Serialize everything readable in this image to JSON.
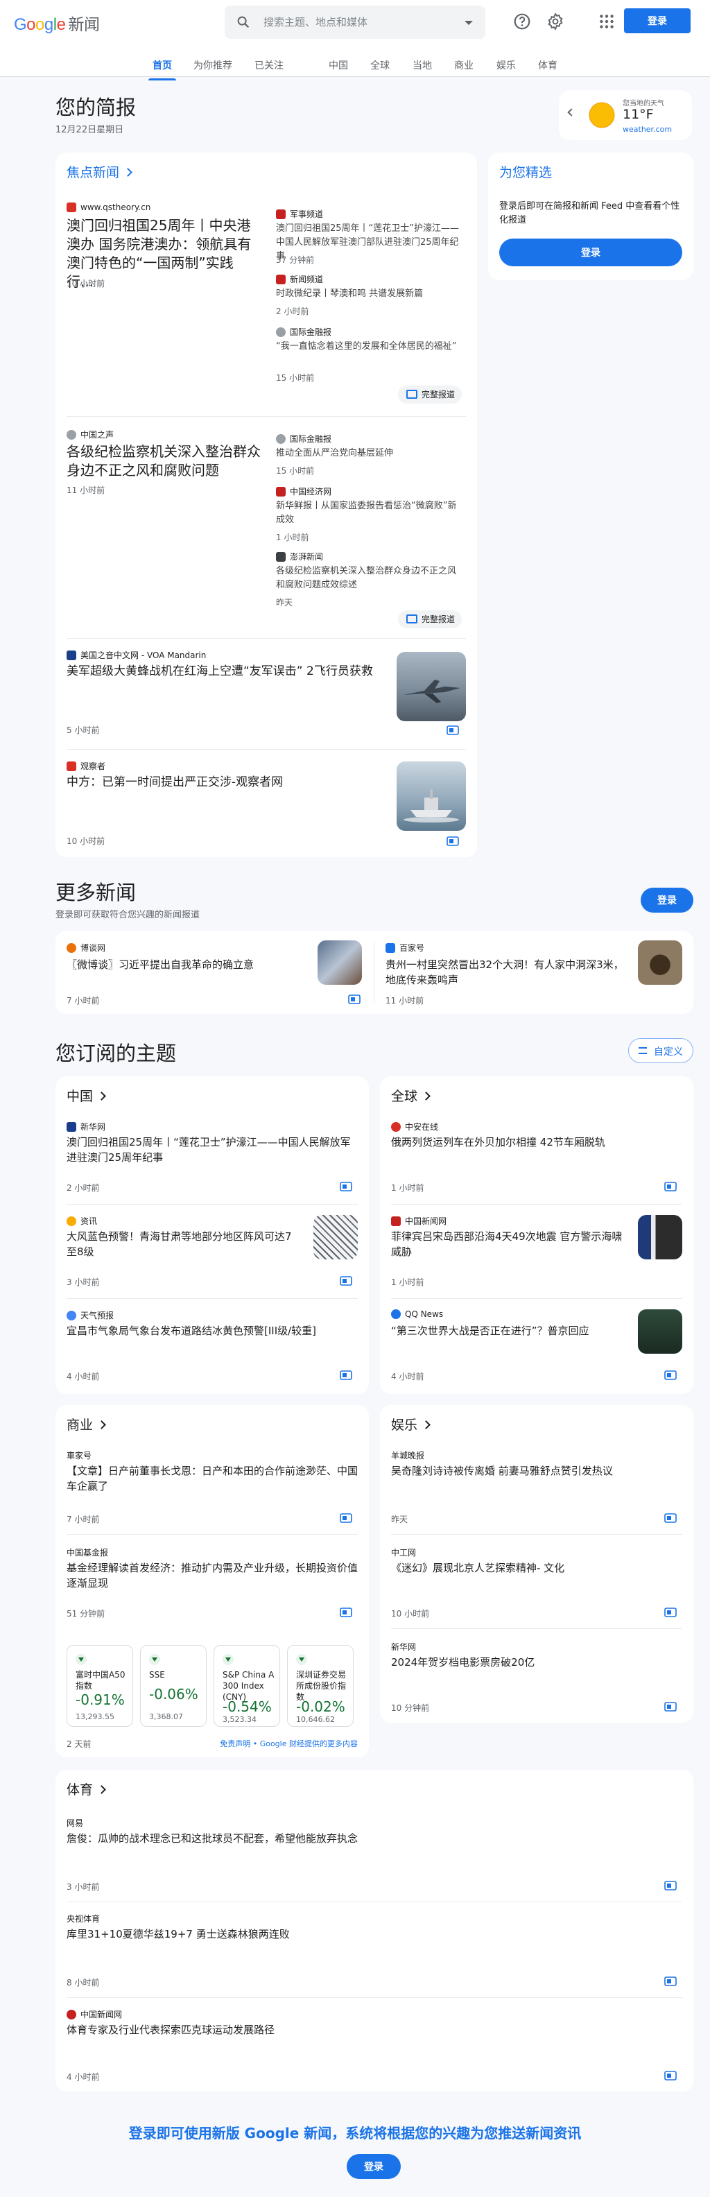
{
  "header": {
    "logo_letters": [
      "G",
      "o",
      "o",
      "g",
      "l",
      "e"
    ],
    "product": "新闻",
    "search_placeholder": "搜索主题、地点和媒体",
    "signin": "登录"
  },
  "tabs": [
    "首页",
    "为你推荐",
    "已关注",
    "中国",
    "全球",
    "当地",
    "商业",
    "娱乐",
    "体育"
  ],
  "briefing": {
    "title": "您的简报",
    "date": "12月22日星期日"
  },
  "weather": {
    "label": "您当地的天气",
    "temp": "11°F",
    "source": "weather.com"
  },
  "picks": {
    "title": "为您精选",
    "desc": "登录后即可在简报和新闻 Feed 中查看看个性化报道",
    "button": "登录"
  },
  "top": {
    "title": "焦点新闻",
    "s1": {
      "main": {
        "source": "www.qstheory.cn",
        "title": "澳门回归祖国25周年丨中央港澳办 国务院港澳办：领航具有澳门特色的“一国两制”实践行...",
        "time": "10 小时前"
      },
      "side": [
        {
          "source": "军事频道",
          "title": "澳门回归祖国25周年丨“莲花卫士”护濠江——中国人民解放军驻澳门部队进驻澳门25周年纪事",
          "time": "37 分钟前"
        },
        {
          "source": "新闻频道",
          "title": "时政微纪录丨琴澳和鸣 共谱发展新篇",
          "time": "2 小时前"
        },
        {
          "source": "国际金融报",
          "title": "“我一直惦念着这里的发展和全体居民的福祉”",
          "time": "15 小时前"
        }
      ],
      "full": "完整报道"
    },
    "s2": {
      "main": {
        "source": "中国之声",
        "title": "各级纪检监察机关深入整治群众身边不正之风和腐败问题",
        "time": "11 小时前"
      },
      "side": [
        {
          "source": "国际金融报",
          "title": "推动全面从严治党向基层延伸",
          "time": "15 小时前"
        },
        {
          "source": "中国经济网",
          "title": "新华鲜报丨从国家监委报告看惩治“微腐败”新成效",
          "time": "1 小时前"
        },
        {
          "source": "澎湃新闻",
          "title": "各级纪检监察机关深入整治群众身边不正之风和腐败问题成效综述",
          "time": "昨天"
        }
      ],
      "full": "完整报道"
    },
    "s3": {
      "source": "美国之音中文网 - VOA Mandarin",
      "title": "美军超级大黄蜂战机在红海上空遭“友军误击” 2飞行员获救",
      "time": "5 小时前"
    },
    "s4": {
      "source": "观察者",
      "title": "中方：已第一时间提出严正交涉-观察者网",
      "time": "10 小时前"
    }
  },
  "more": {
    "title": "更多新闻",
    "desc": "登录即可获取符合您兴趣的新闻报道",
    "button": "登录",
    "items": [
      {
        "source": "博谈网",
        "title": "〖微博谈〗习近平提出自我革命的确立意",
        "time": "7 小时前"
      },
      {
        "source": "百家号",
        "title": "贵州一村里突然冒出32个大洞！有人家中洞深3米，地底传来轰鸣声",
        "time": "11 小时前"
      }
    ]
  },
  "topics": {
    "title": "您订阅的主题",
    "custom": "自定义",
    "china": {
      "title": "中国",
      "items": [
        {
          "source": "新华网",
          "title": "澳门回归祖国25周年丨“莲花卫士”护濠江——中国人民解放军进驻澳门25周年纪事",
          "time": "2 小时前"
        },
        {
          "source": "资讯",
          "title": "大风蓝色预警！青海甘肃等地部分地区阵风可达7至8级",
          "time": "3 小时前"
        },
        {
          "source": "天气预报",
          "title": "宜昌市气象局气象台发布道路结冰黄色预警[III级/较重]",
          "time": "4 小时前"
        }
      ]
    },
    "world": {
      "title": "全球",
      "items": [
        {
          "source": "中安在线",
          "title": "俄两列货运列车在外贝加尔相撞 42节车厢脱轨",
          "time": "1 小时前"
        },
        {
          "source": "中国新闻网",
          "title": "菲律宾吕宋岛西部沿海4天49次地震 官方警示海啸威胁",
          "time": "1 小时前"
        },
        {
          "source": "QQ News",
          "title": "“第三次世界大战是否正在进行”？普京回应",
          "time": "4 小时前"
        }
      ]
    },
    "business": {
      "title": "商业",
      "items": [
        {
          "source": "車家号",
          "title": "【文章】日产前董事长戈恩：日产和本田的合作前途渺茫、中国车企赢了",
          "time": "7 小时前"
        },
        {
          "source": "中国基金报",
          "title": "基金经理解读首发经济：推动扩内需及产业升级，长期投资价值逐渐显现",
          "time": "51 分钟前"
        }
      ],
      "stocks": [
        {
          "name": "富时中国A50指数",
          "change": "-0.91%",
          "value": "13,293.55"
        },
        {
          "name": "SSE",
          "change": "-0.06%",
          "value": "3,368.07"
        },
        {
          "name": "S&P China A 300 Index (CNY)",
          "change": "-0.54%",
          "value": "3,523.34"
        },
        {
          "name": "深圳证券交易所成份股价指数",
          "change": "-0.02%",
          "value": "10,646.62"
        }
      ],
      "stocks_time": "2 天前",
      "disclaimer": "免责声明 • Google 财经提供的更多内容"
    },
    "ent": {
      "title": "娱乐",
      "items": [
        {
          "source": "羊城晚报",
          "title": "吴奇隆刘诗诗被传离婚 前妻马雅舒点赞引发热议",
          "time": "昨天"
        },
        {
          "source": "中工网",
          "title": "《迷幻》展现北京人艺探索精神- 文化",
          "time": "10 小时前"
        },
        {
          "source": "新华网",
          "title": "2024年贺岁档电影票房破20亿",
          "time": "10 分钟前"
        }
      ]
    },
    "sports": {
      "title": "体育",
      "items": [
        {
          "source": "网易",
          "title": "詹俊：瓜帅的战术理念已和这批球员不配套，希望他能放弃执念",
          "time": "3 小时前"
        },
        {
          "source": "央视体育",
          "title": "库里31+10夏德华兹19+7 勇士送森林狼两连败",
          "time": "8 小时前"
        },
        {
          "source": "中国新闻网",
          "title": "体育专家及行业代表探索匹克球运动发展路径",
          "time": "4 小时前"
        }
      ]
    }
  },
  "footer": {
    "text": "登录即可使用新版 Google 新闻，系统将根据您的兴趣为您推送新闻资讯",
    "button": "登录"
  },
  "colors": {
    "accent": "#1a73e8",
    "brand_red": "#ea4335",
    "green": "#137333",
    "bg": "#f6f8fc"
  }
}
